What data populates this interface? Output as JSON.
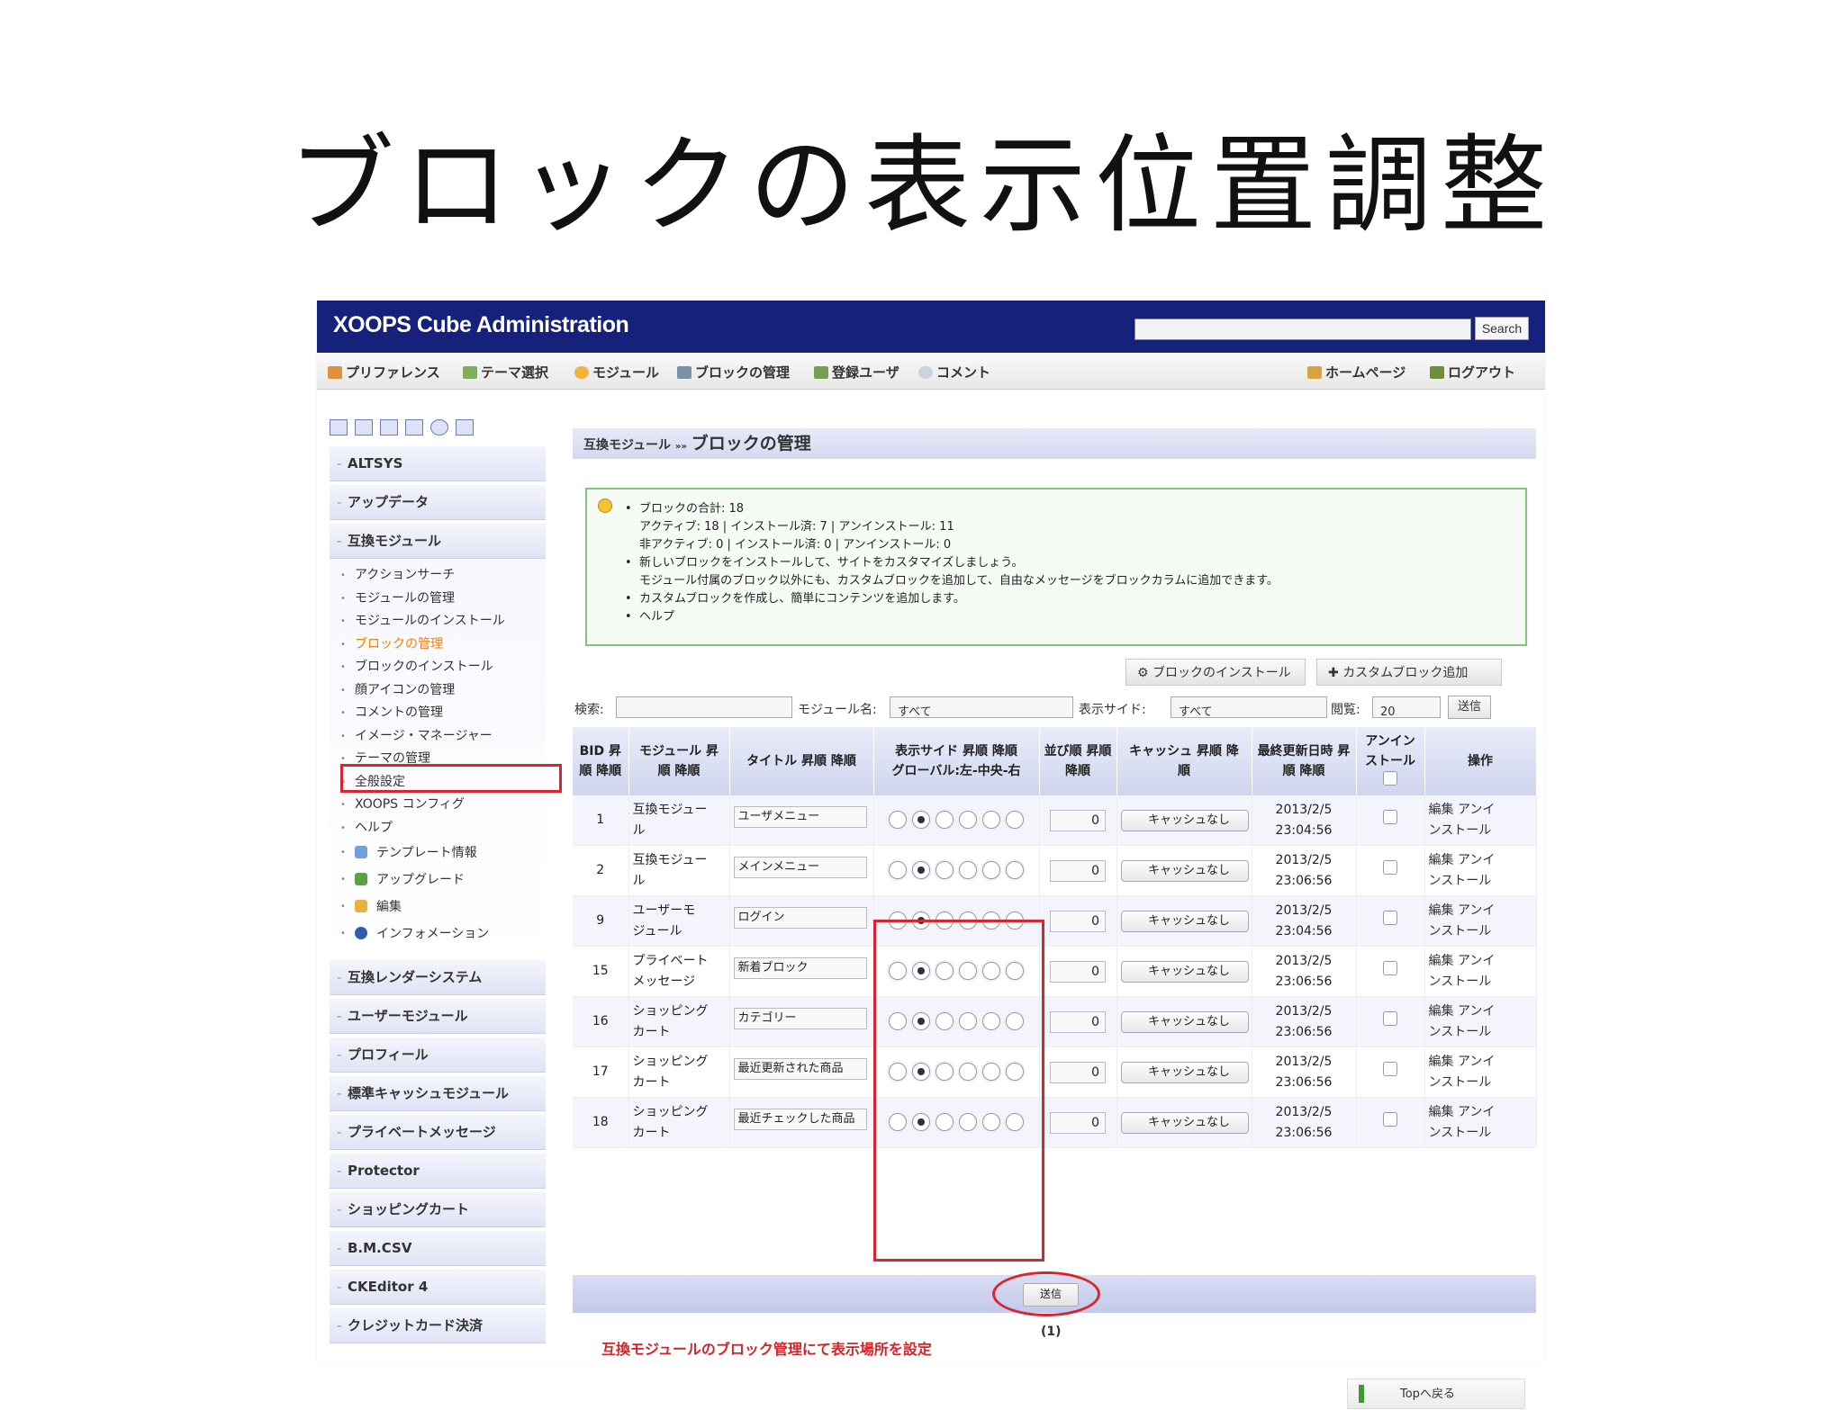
{
  "slide": {
    "title": "ブロックの表示位置調整"
  },
  "header": {
    "app_title": "XOOPS Cube Administration",
    "search_button": "Search"
  },
  "topnav": {
    "items": [
      "プリファレンス",
      "テーマ選択",
      "モジュール",
      "ブロックの管理",
      "登録ユーザ",
      "コメント"
    ],
    "right": [
      "ホームページ",
      "ログアウト"
    ]
  },
  "sidebar": {
    "categories_top": [
      "ALTSYS",
      "アップデータ",
      "互換モジュール"
    ],
    "sub_items": [
      "アクションサーチ",
      "モジュールの管理",
      "モジュールのインストール",
      "ブロックの管理",
      "ブロックのインストール",
      "顔アイコンの管理",
      "コメントの管理",
      "イメージ・マネージャー",
      "テーマの管理",
      "全般設定",
      "XOOPS コンフィグ",
      "ヘルプ"
    ],
    "sub_items_icon": [
      "テンプレート情報",
      "アップグレード",
      "編集",
      "インフォメーション"
    ],
    "categories_bottom": [
      "互換レンダーシステム",
      "ユーザーモジュール",
      "プロフィール",
      "標準キャッシュモジュール",
      "プライベートメッセージ",
      "Protector",
      "ショッピングカート",
      "B.M.CSV",
      "CKEditor 4",
      "クレジットカード決済"
    ]
  },
  "main": {
    "breadcrumb_module": "互換モジュール",
    "breadcrumb_sep": "»»",
    "breadcrumb_page": "ブロックの管理",
    "info": {
      "l1": "ブロックの合計: 18",
      "l2": "アクティブ: 18 | インストール済: 7 | アンインストール: 11",
      "l3": "非アクティブ: 0 | インストール済: 0 | アンインストール: 0",
      "l4": "新しいブロックをインストールして、サイトをカスタマイズしましょう。",
      "l5": "モジュール付属のブロック以外にも、カスタムブロックを追加して、自由なメッセージをブロックカラムに追加できます。",
      "l6": "カスタムブロックを作成し、簡単にコンテンツを追加します。",
      "l7": "ヘルプ"
    },
    "btn_install": "ブロックのインストール",
    "btn_custom": "カスタムブロック追加",
    "filter": {
      "search_label": "検索:",
      "module_label": "モジュール名:",
      "module_value": "すべて",
      "side_label": "表示サイド:",
      "side_value": "すべて",
      "view_label": "閲覧:",
      "view_value": "20",
      "submit": "送信"
    },
    "columns": {
      "bid_1": "BID 昇",
      "bid_2": "順 降順",
      "module_1": "モジュール 昇",
      "module_2": "順 降順",
      "title": "タイトル 昇順 降順",
      "side_1": "表示サイド 昇順 降順",
      "side_2": "グローバル:左-中央-右",
      "order_1": "並び順 昇順",
      "order_2": "降順",
      "cache_1": "キャッシュ 昇順 降",
      "cache_2": "順",
      "updated_1": "最終更新日時 昇",
      "updated_2": "順 降順",
      "uninstall_1": "アンイン",
      "uninstall_2": "ストール",
      "ops": "操作"
    },
    "rows": [
      {
        "bid": "1",
        "m1": "互換モジュー",
        "m2": "ル",
        "title": "ユーザメニュー",
        "order": "0",
        "cache": "キャッシュなし",
        "d": "2013/2/5",
        "t": "23:04:56",
        "op1": "編集 アンイ",
        "op2": "ンストール"
      },
      {
        "bid": "2",
        "m1": "互換モジュー",
        "m2": "ル",
        "title": "メインメニュー",
        "order": "0",
        "cache": "キャッシュなし",
        "d": "2013/2/5",
        "t": "23:06:56",
        "op1": "編集 アンイ",
        "op2": "ンストール"
      },
      {
        "bid": "9",
        "m1": "ユーザーモ",
        "m2": "ジュール",
        "title": "ログイン",
        "order": "0",
        "cache": "キャッシュなし",
        "d": "2013/2/5",
        "t": "23:04:56",
        "op1": "編集 アンイ",
        "op2": "ンストール"
      },
      {
        "bid": "15",
        "m1": "プライベート",
        "m2": "メッセージ",
        "title": "新着ブロック",
        "order": "0",
        "cache": "キャッシュなし",
        "d": "2013/2/5",
        "t": "23:06:56",
        "op1": "編集 アンイ",
        "op2": "ンストール"
      },
      {
        "bid": "16",
        "m1": "ショッピング",
        "m2": "カート",
        "title": "カテゴリー",
        "order": "0",
        "cache": "キャッシュなし",
        "d": "2013/2/5",
        "t": "23:06:56",
        "op1": "編集 アンイ",
        "op2": "ンストール"
      },
      {
        "bid": "17",
        "m1": "ショッピング",
        "m2": "カート",
        "title": "最近更新された商品",
        "order": "0",
        "cache": "キャッシュなし",
        "d": "2013/2/5",
        "t": "23:06:56",
        "op1": "編集 アンイ",
        "op2": "ンストール"
      },
      {
        "bid": "18",
        "m1": "ショッピング",
        "m2": "カート",
        "title": "最近チェックした商品",
        "order": "0",
        "cache": "キャッシュなし",
        "d": "2013/2/5",
        "t": "23:06:56",
        "op1": "編集 アンイ",
        "op2": "ンストール"
      }
    ],
    "submit": "送信",
    "pager": "(1)",
    "note": "互換モジュールのブロック管理にて表示場所を設定",
    "back_to_top": "Topへ戻る"
  },
  "colors": {
    "header": "#16217c",
    "annotation_red": "#d9262d",
    "info_border": "#7ec87a"
  }
}
